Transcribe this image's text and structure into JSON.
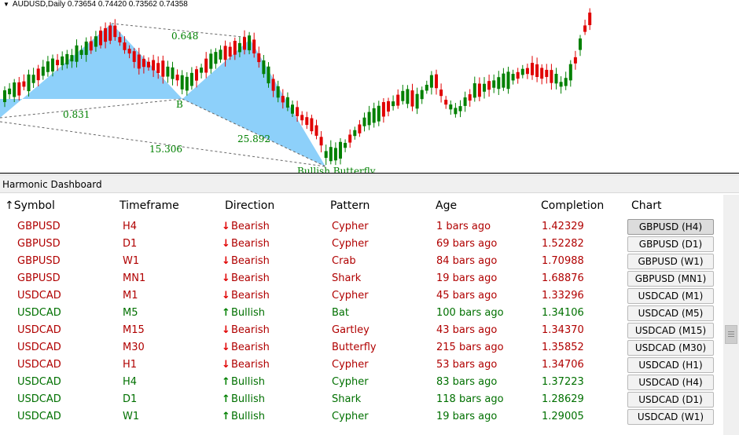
{
  "chart": {
    "title": "AUDUSD,Daily  0.73654 0.74420 0.73562 0.74358",
    "pattern_label": "Bullish Butterfly",
    "point_label_b": "B",
    "ratios": [
      "0.648",
      "0.831",
      "15.306",
      "25.892"
    ],
    "colors": {
      "bull_candle": "#008000",
      "bear_candle": "#e00000",
      "pattern_fill": "#87cefa",
      "ratio_text": "#008000"
    }
  },
  "dashboard": {
    "title": "Harmonic Dashboard",
    "columns": [
      "Symbol",
      "Timeframe",
      "Direction",
      "Pattern",
      "Age",
      "Completion",
      "Chart"
    ],
    "sort_indicator": "↑",
    "rows": [
      {
        "symbol": "GBPUSD",
        "timeframe": "H4",
        "direction": "Bearish",
        "arrow": "🡓",
        "pattern": "Cypher",
        "age": "1 bars ago",
        "completion": "1.42329",
        "chart": "GBPUSD (H4)",
        "dir": "bear",
        "active": true
      },
      {
        "symbol": "GBPUSD",
        "timeframe": "D1",
        "direction": "Bearish",
        "arrow": "🡓",
        "pattern": "Cypher",
        "age": "69 bars ago",
        "completion": "1.52282",
        "chart": "GBPUSD (D1)",
        "dir": "bear"
      },
      {
        "symbol": "GBPUSD",
        "timeframe": "W1",
        "direction": "Bearish",
        "arrow": "🡓",
        "pattern": "Crab",
        "age": "84 bars ago",
        "completion": "1.70988",
        "chart": "GBPUSD (W1)",
        "dir": "bear"
      },
      {
        "symbol": "GBPUSD",
        "timeframe": "MN1",
        "direction": "Bearish",
        "arrow": "🡓",
        "pattern": "Shark",
        "age": "19 bars ago",
        "completion": "1.68876",
        "chart": "GBPUSD (MN1)",
        "dir": "bear"
      },
      {
        "symbol": "USDCAD",
        "timeframe": "M1",
        "direction": "Bearish",
        "arrow": "🡓",
        "pattern": "Cypher",
        "age": "45 bars ago",
        "completion": "1.33296",
        "chart": "USDCAD (M1)",
        "dir": "bear"
      },
      {
        "symbol": "USDCAD",
        "timeframe": "M5",
        "direction": "Bullish",
        "arrow": "🡑",
        "pattern": "Bat",
        "age": "100 bars ago",
        "completion": "1.34106",
        "chart": "USDCAD (M5)",
        "dir": "bull"
      },
      {
        "symbol": "USDCAD",
        "timeframe": "M15",
        "direction": "Bearish",
        "arrow": "🡓",
        "pattern": "Gartley",
        "age": "43 bars ago",
        "completion": "1.34370",
        "chart": "USDCAD (M15)",
        "dir": "bear"
      },
      {
        "symbol": "USDCAD",
        "timeframe": "M30",
        "direction": "Bearish",
        "arrow": "🡓",
        "pattern": "Butterfly",
        "age": "215 bars ago",
        "completion": "1.35852",
        "chart": "USDCAD (M30)",
        "dir": "bear"
      },
      {
        "symbol": "USDCAD",
        "timeframe": "H1",
        "direction": "Bearish",
        "arrow": "🡓",
        "pattern": "Cypher",
        "age": "53 bars ago",
        "completion": "1.34706",
        "chart": "USDCAD (H1)",
        "dir": "bear"
      },
      {
        "symbol": "USDCAD",
        "timeframe": "H4",
        "direction": "Bullish",
        "arrow": "🡑",
        "pattern": "Cypher",
        "age": "83 bars ago",
        "completion": "1.37223",
        "chart": "USDCAD (H4)",
        "dir": "bull"
      },
      {
        "symbol": "USDCAD",
        "timeframe": "D1",
        "direction": "Bullish",
        "arrow": "🡑",
        "pattern": "Shark",
        "age": "118 bars ago",
        "completion": "1.28629",
        "chart": "USDCAD (D1)",
        "dir": "bull"
      },
      {
        "symbol": "USDCAD",
        "timeframe": "W1",
        "direction": "Bullish",
        "arrow": "🡑",
        "pattern": "Cypher",
        "age": "19 bars ago",
        "completion": "1.29005",
        "chart": "USDCAD (W1)",
        "dir": "bull"
      }
    ]
  }
}
